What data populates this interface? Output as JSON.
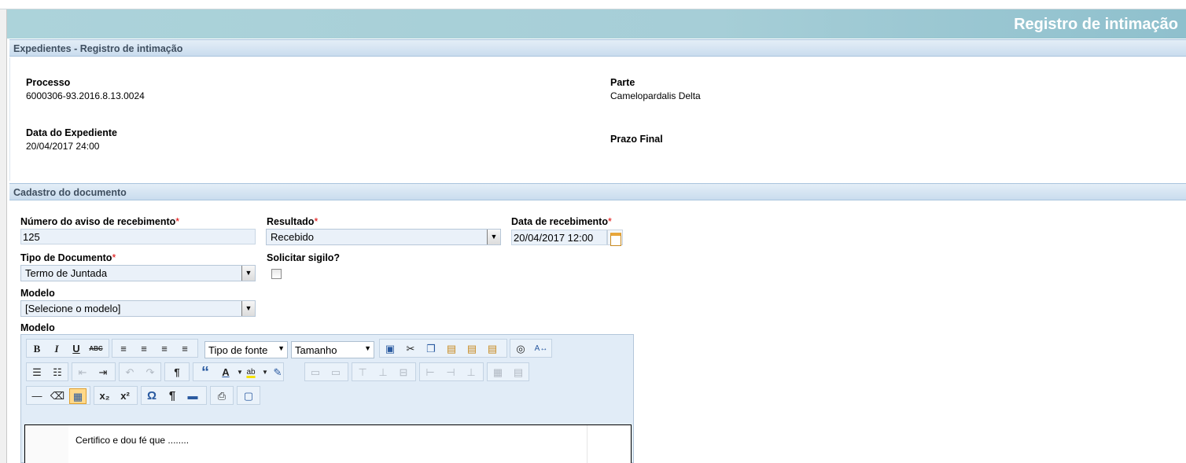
{
  "header": {
    "title": "Registro de intimação"
  },
  "expediente": {
    "panel_title": "Expedientes - Registro de intimação",
    "processo_label": "Processo",
    "processo_value": "6000306-93.2016.8.13.0024",
    "parte_label": "Parte",
    "parte_value": "Camelopardalis Delta",
    "data_label": "Data do Expediente",
    "data_value": "20/04/2017 24:00",
    "prazo_label": "Prazo Final"
  },
  "cadastro": {
    "panel_title": "Cadastro do documento",
    "required_mark": "*",
    "numero_label": "Número do aviso de recebimento",
    "numero_value": "125",
    "resultado_label": "Resultado",
    "resultado_value": "Recebido",
    "data_receb_label": "Data de recebimento",
    "data_receb_value": "20/04/2017 12:00",
    "tipo_label": "Tipo de Documento",
    "tipo_value": "Termo de Juntada",
    "sigilo_label": "Solicitar sigilo?",
    "modelo_label": "Modelo",
    "modelo_value": "[Selecione o modelo]",
    "editor_label": "Modelo"
  },
  "editor": {
    "font_family_placeholder": "Tipo de fonte",
    "font_size_placeholder": "Tamanho",
    "bold": "B",
    "italic": "I",
    "underline": "U",
    "strike": "ABC",
    "subscript": "x₂",
    "superscript": "x²",
    "omega": "Ω",
    "pilcrow": "¶",
    "quote": "“",
    "content": "Certifico e dou fé que ........"
  }
}
